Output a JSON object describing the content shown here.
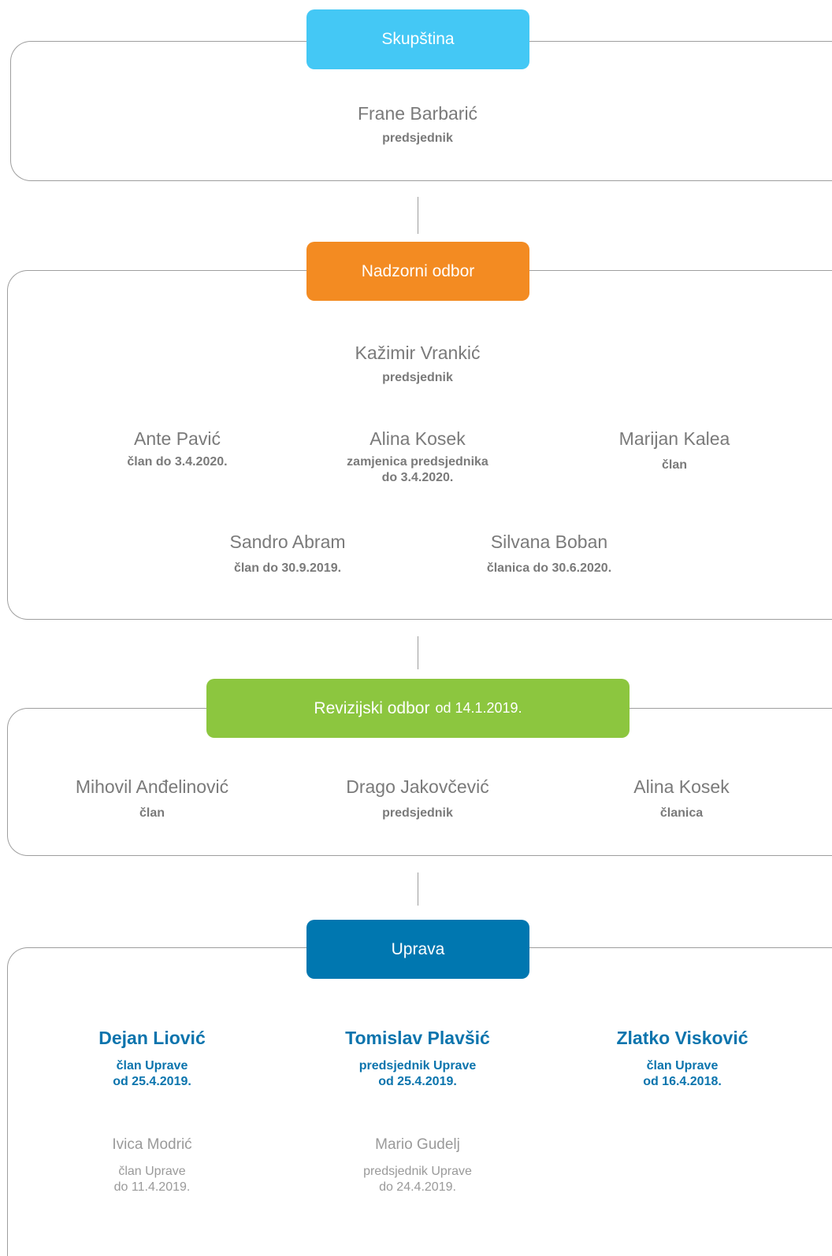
{
  "skupstina": {
    "title": "Skupština",
    "color": "#44c8f5",
    "president": {
      "name": "Frane Barbarić",
      "role": "predsjednik"
    }
  },
  "nadzorni": {
    "title": "Nadzorni odbor",
    "color": "#f38b22",
    "president": {
      "name": "Kažimir Vrankić",
      "role": "predsjednik"
    },
    "row1": [
      {
        "name": "Ante Pavić",
        "role": "član do 3.4.2020."
      },
      {
        "name": "Alina Kosek",
        "role_line1": "zamjenica predsjednika",
        "role_line2": "do 3.4.2020."
      },
      {
        "name": "Marijan Kalea",
        "role": "član"
      }
    ],
    "row2": [
      {
        "name": "Sandro Abram",
        "role": "član do 30.9.2019."
      },
      {
        "name": "Silvana Boban",
        "role": "članica do 30.6.2020."
      }
    ]
  },
  "revizijski": {
    "title_main": "Revizijski odbor",
    "title_date": "od 14.1.2019.",
    "color": "#8cc63f",
    "members": [
      {
        "name": "Mihovil Anđelinović",
        "role": "član"
      },
      {
        "name": "Drago Jakovčević",
        "role": "predsjednik"
      },
      {
        "name": "Alina Kosek",
        "role": "članica"
      }
    ]
  },
  "uprava": {
    "title": "Uprava",
    "color": "#0077b0",
    "current": [
      {
        "name": "Dejan Liović",
        "role_line1": "član Uprave",
        "role_line2": "od 25.4.2019."
      },
      {
        "name": "Tomislav Plavšić",
        "role_line1": "predsjednik Uprave",
        "role_line2": "od 25.4.2019."
      },
      {
        "name": "Zlatko Visković",
        "role_line1": "član Uprave",
        "role_line2": "od 16.4.2018."
      }
    ],
    "former": [
      {
        "name": "Ivica Modrić",
        "role_line1": "član Uprave",
        "role_line2": "do 11.4.2019."
      },
      {
        "name": "Mario Gudelj",
        "role_line1": "predsjednik Uprave",
        "role_line2": "do 24.4.2019."
      }
    ]
  }
}
